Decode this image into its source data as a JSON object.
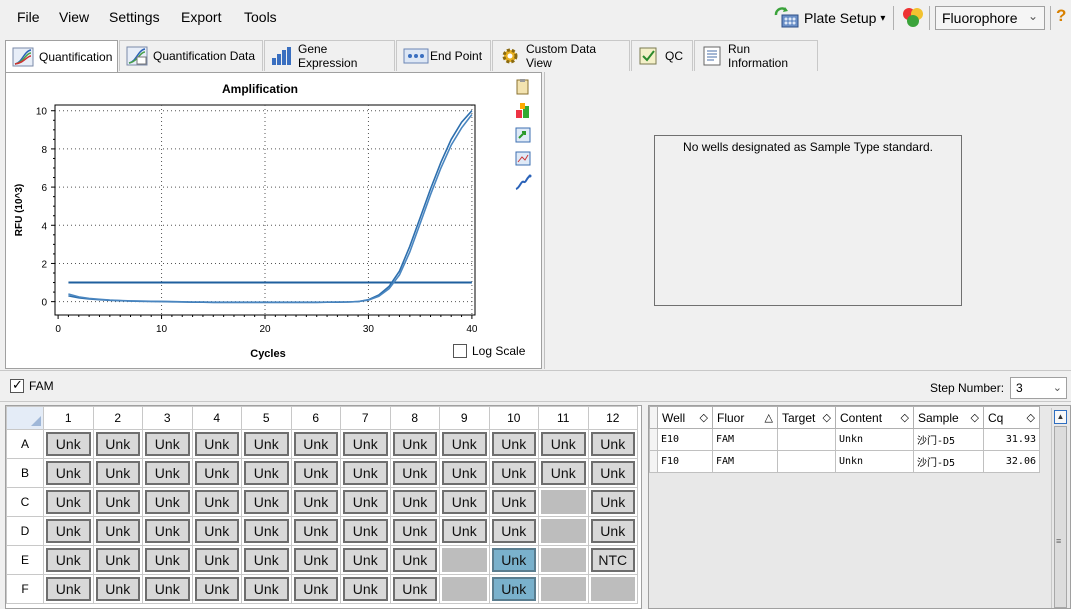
{
  "menu": [
    "File",
    "View",
    "Settings",
    "Export",
    "Tools"
  ],
  "toolbar": {
    "plate_setup_label": "Plate Setup",
    "plate_setup_caret": "▾",
    "fluorophore_value": "Fluorophore",
    "fluorophore_caret": "⌄",
    "help": "?"
  },
  "tabs": [
    {
      "label": "Quantification",
      "icon": "amplification-curve-icon",
      "active": true
    },
    {
      "label": "Quantification Data",
      "icon": "amplification-curve-icon",
      "active": false
    },
    {
      "label": "Gene Expression",
      "icon": "bar-chart-icon",
      "active": false
    },
    {
      "label": "End Point",
      "icon": "end-point-icon",
      "active": false
    },
    {
      "label": "Custom Data View",
      "icon": "gear-icon",
      "active": false
    },
    {
      "label": "QC",
      "icon": "qc-check-icon",
      "active": false
    },
    {
      "label": "Run Information",
      "icon": "run-info-icon",
      "active": false
    }
  ],
  "chart_data": {
    "type": "line",
    "title": "Amplification",
    "xlabel": "Cycles",
    "ylabel": "RFU (10^3)",
    "xlim": [
      0,
      40
    ],
    "ylim": [
      0,
      10
    ],
    "xticks": [
      0,
      10,
      20,
      30,
      40
    ],
    "yticks": [
      0,
      2,
      4,
      6,
      8,
      10
    ],
    "grid": true,
    "threshold": 1.0,
    "series": [
      {
        "x": [
          1,
          2,
          3,
          4,
          5,
          6,
          7,
          8,
          9,
          10,
          11,
          12,
          13,
          14,
          15,
          16,
          17,
          18,
          19,
          20,
          21,
          22,
          23,
          24,
          25,
          26,
          27,
          28,
          29,
          30,
          31,
          32,
          33,
          34,
          35,
          36,
          37,
          38,
          39,
          40
        ],
        "y": [
          0.3,
          0.2,
          0.14,
          0.1,
          0.07,
          0.05,
          0.03,
          0.02,
          0.01,
          0.0,
          -0.01,
          -0.02,
          -0.03,
          -0.03,
          -0.04,
          -0.04,
          -0.04,
          -0.04,
          -0.04,
          -0.04,
          -0.04,
          -0.04,
          -0.04,
          -0.04,
          -0.04,
          -0.03,
          -0.03,
          -0.02,
          0.0,
          0.1,
          0.35,
          0.8,
          1.6,
          2.9,
          4.4,
          5.9,
          7.3,
          8.5,
          9.4,
          10.0
        ]
      },
      {
        "x": [
          1,
          2,
          3,
          4,
          5,
          6,
          7,
          8,
          9,
          10,
          11,
          12,
          13,
          14,
          15,
          16,
          17,
          18,
          19,
          20,
          21,
          22,
          23,
          24,
          25,
          26,
          27,
          28,
          29,
          30,
          31,
          32,
          33,
          34,
          35,
          36,
          37,
          38,
          39,
          40
        ],
        "y": [
          0.4,
          0.25,
          0.17,
          0.12,
          0.08,
          0.06,
          0.04,
          0.03,
          0.02,
          0.01,
          0.0,
          -0.01,
          -0.02,
          -0.02,
          -0.03,
          -0.03,
          -0.03,
          -0.03,
          -0.03,
          -0.03,
          -0.03,
          -0.03,
          -0.03,
          -0.03,
          -0.03,
          -0.03,
          -0.02,
          -0.02,
          0.0,
          0.08,
          0.28,
          0.68,
          1.4,
          2.6,
          4.1,
          5.6,
          7.0,
          8.2,
          9.1,
          9.8
        ]
      }
    ],
    "log_scale_label": "Log Scale",
    "log_scale_checked": false
  },
  "standard_panel": {
    "message": "No wells designated as Sample Type standard."
  },
  "fluor_filter": {
    "label": "FAM",
    "checked": true
  },
  "step": {
    "label": "Step Number:",
    "value": "3",
    "caret": "⌄"
  },
  "plate": {
    "columns": [
      "1",
      "2",
      "3",
      "4",
      "5",
      "6",
      "7",
      "8",
      "9",
      "10",
      "11",
      "12"
    ],
    "rows": [
      {
        "label": "A",
        "wells": [
          "Unk",
          "Unk",
          "Unk",
          "Unk",
          "Unk",
          "Unk",
          "Unk",
          "Unk",
          "Unk",
          "Unk",
          "Unk",
          "Unk"
        ]
      },
      {
        "label": "B",
        "wells": [
          "Unk",
          "Unk",
          "Unk",
          "Unk",
          "Unk",
          "Unk",
          "Unk",
          "Unk",
          "Unk",
          "Unk",
          "Unk",
          "Unk"
        ]
      },
      {
        "label": "C",
        "wells": [
          "Unk",
          "Unk",
          "Unk",
          "Unk",
          "Unk",
          "Unk",
          "Unk",
          "Unk",
          "Unk",
          "Unk",
          "",
          "Unk"
        ]
      },
      {
        "label": "D",
        "wells": [
          "Unk",
          "Unk",
          "Unk",
          "Unk",
          "Unk",
          "Unk",
          "Unk",
          "Unk",
          "Unk",
          "Unk",
          "",
          "Unk"
        ]
      },
      {
        "label": "E",
        "wells": [
          "Unk",
          "Unk",
          "Unk",
          "Unk",
          "Unk",
          "Unk",
          "Unk",
          "Unk",
          "",
          "Unk",
          "",
          "NTC"
        ]
      },
      {
        "label": "F",
        "wells": [
          "Unk",
          "Unk",
          "Unk",
          "Unk",
          "Unk",
          "Unk",
          "Unk",
          "Unk",
          "",
          "Unk",
          "",
          ""
        ]
      }
    ],
    "selected": [
      "E10",
      "F10"
    ]
  },
  "results": {
    "columns": [
      {
        "label": "Well",
        "sort": "◇"
      },
      {
        "label": "Fluor",
        "sort": "△"
      },
      {
        "label": "Target",
        "sort": "◇"
      },
      {
        "label": "Content",
        "sort": "◇"
      },
      {
        "label": "Sample",
        "sort": "◇"
      },
      {
        "label": "Cq",
        "sort": "◇"
      }
    ],
    "rows": [
      [
        "E10",
        "FAM",
        "",
        "Unkn",
        "沙门-D5",
        "31.93"
      ],
      [
        "F10",
        "FAM",
        "",
        "Unkn",
        "沙门-D5",
        "32.06"
      ]
    ]
  }
}
